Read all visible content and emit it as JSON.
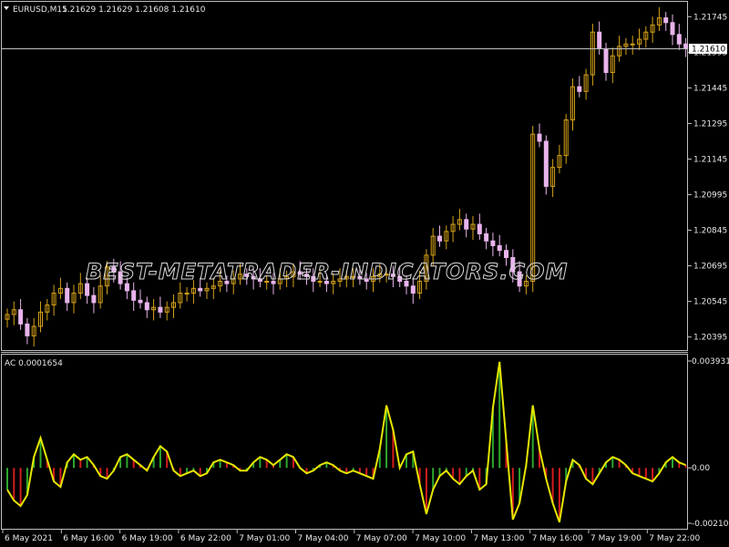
{
  "main": {
    "symbol_label": "EURUSD,M15",
    "ohlc": "1.21629 1.21629 1.21608 1.21610",
    "current_price": "1.21610",
    "price_levels": [
      "1.21745",
      "1.21595",
      "1.21445",
      "1.21295",
      "1.21145",
      "1.20995",
      "1.20845",
      "1.20695",
      "1.20545",
      "1.20395"
    ],
    "price_min": 1.2034,
    "price_max": 1.218,
    "watermark": "BEST-METATRADER-INDICATORS.COM"
  },
  "indicator": {
    "label": "AC 0.0001654",
    "levels": [
      "0.0039311",
      "0.00",
      "-0.0021058"
    ],
    "max": 0.0039311,
    "min": -0.0021058
  },
  "time_axis": [
    "6 May 2021",
    "6 May 16:00",
    "6 May 19:00",
    "6 May 22:00",
    "7 May 01:00",
    "7 May 04:00",
    "7 May 07:00",
    "7 May 10:00",
    "7 May 13:00",
    "7 May 16:00",
    "7 May 19:00",
    "7 May 22:00"
  ],
  "colors": {
    "background": "#000000",
    "bull_candle": "#d4a017",
    "bear_candle": "#e8b4ec",
    "ac_up": "#2ea82e",
    "ac_down": "#d41c1c",
    "ac_line": "#e6e600",
    "grid": "#c0c0c0",
    "text": "#e8e8e8"
  },
  "chart_data": {
    "type": "candlestick",
    "title": "EURUSD,M15",
    "close_series": [
      1.2049,
      1.2051,
      1.2045,
      1.204,
      1.2044,
      1.205,
      1.2053,
      1.2058,
      1.206,
      1.2054,
      1.2058,
      1.2062,
      1.2057,
      1.2054,
      1.2061,
      1.2069,
      1.2067,
      1.2062,
      1.2059,
      1.2055,
      1.2054,
      1.2051,
      1.2052,
      1.205,
      1.2052,
      1.2054,
      1.2058,
      1.2058,
      1.206,
      1.2059,
      1.206,
      1.2061,
      1.2063,
      1.2062,
      1.2064,
      1.2066,
      1.2065,
      1.2064,
      1.2063,
      1.2063,
      1.2062,
      1.2064,
      1.2065,
      1.2067,
      1.2066,
      1.2065,
      1.2063,
      1.2063,
      1.2062,
      1.2063,
      1.2064,
      1.2065,
      1.2065,
      1.2064,
      1.2063,
      1.2065,
      1.2066,
      1.2066,
      1.2065,
      1.2063,
      1.2061,
      1.2058,
      1.2063,
      1.2074,
      1.2082,
      1.208,
      1.2084,
      1.2087,
      1.2089,
      1.2085,
      1.2087,
      1.2083,
      1.208,
      1.2078,
      1.2076,
      1.2073,
      1.2067,
      1.2061,
      1.2063,
      1.2125,
      1.2122,
      1.2103,
      1.2111,
      1.2116,
      1.2131,
      1.2145,
      1.2143,
      1.215,
      1.2168,
      1.2161,
      1.2151,
      1.2158,
      1.2162,
      1.2163,
      1.2163,
      1.2165,
      1.2168,
      1.2171,
      1.2174,
      1.2172,
      1.2167,
      1.2163,
      1.2161
    ],
    "ac_series": [
      -0.0008,
      -0.0012,
      -0.0014,
      -0.001,
      0.0004,
      0.0011,
      0.0003,
      -0.0005,
      -0.0007,
      0.0002,
      0.0005,
      0.0003,
      0.0004,
      0.0001,
      -0.0003,
      -0.0004,
      -0.0001,
      0.0004,
      0.0005,
      0.0003,
      0.0001,
      -0.0001,
      0.0004,
      0.0008,
      0.0006,
      -0.0001,
      -0.0003,
      -0.0002,
      -0.0001,
      -0.0003,
      -0.0002,
      0.0002,
      0.0003,
      0.0002,
      0.0001,
      -0.0001,
      -0.0001,
      0.0002,
      0.0004,
      0.0003,
      0.0001,
      0.0003,
      0.0005,
      0.0004,
      0.0,
      -0.0002,
      -0.0001,
      0.0001,
      0.0002,
      0.0001,
      -0.0001,
      -0.0002,
      -0.0001,
      -0.0002,
      -0.0003,
      -0.0004,
      0.0007,
      0.0023,
      0.0014,
      0.0,
      0.0005,
      0.0006,
      -0.0006,
      -0.0017,
      -0.0008,
      -0.0003,
      -0.0001,
      -0.0004,
      -0.0006,
      -0.0003,
      -0.0001,
      -0.0008,
      -0.0006,
      0.0022,
      0.0039,
      0.001,
      -0.0019,
      -0.0013,
      0.0001,
      0.0023,
      0.0007,
      -0.0004,
      -0.0013,
      -0.002,
      -0.0005,
      0.0003,
      0.0001,
      -0.0004,
      -0.0006,
      -0.0002,
      0.0002,
      0.0004,
      0.0003,
      0.0001,
      -0.0002,
      -0.0003,
      -0.0004,
      -0.0005,
      -0.0002,
      0.0002,
      0.0004,
      0.0002,
      0.0001
    ]
  }
}
